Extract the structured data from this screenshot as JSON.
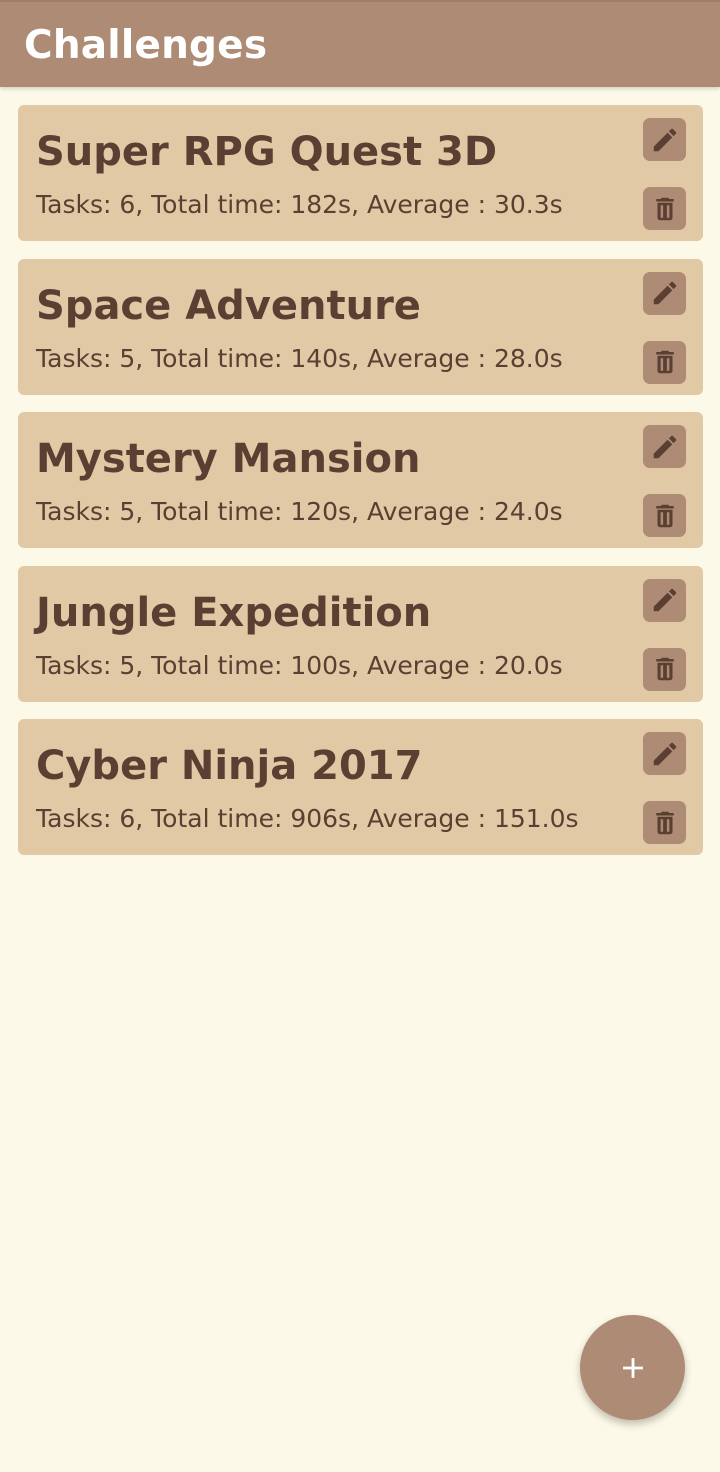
{
  "app_bar": {
    "title": "Challenges",
    "color": "#ae8b74"
  },
  "colors": {
    "background": "#fdf9e8",
    "card": "#e2c9a5",
    "text": "#5b3f33",
    "button": "#ae8b74"
  },
  "challenges": [
    {
      "title": "Super RPG Quest 3D",
      "stats": "Tasks: 6, Total time: 182s, Average : 30.3s",
      "edit_icon": "pencil-icon",
      "delete_icon": "trash-icon"
    },
    {
      "title": "Space Adventure",
      "stats": "Tasks: 5, Total time: 140s, Average : 28.0s",
      "edit_icon": "pencil-icon",
      "delete_icon": "trash-icon"
    },
    {
      "title": "Mystery Mansion",
      "stats": "Tasks: 5, Total time: 120s, Average : 24.0s",
      "edit_icon": "pencil-icon",
      "delete_icon": "trash-icon"
    },
    {
      "title": "Jungle Expedition",
      "stats": "Tasks: 5, Total time: 100s, Average : 20.0s",
      "edit_icon": "pencil-icon",
      "delete_icon": "trash-icon"
    },
    {
      "title": "Cyber Ninja 2017",
      "stats": "Tasks: 6, Total time: 906s, Average : 151.0s",
      "edit_icon": "pencil-icon",
      "delete_icon": "trash-icon"
    }
  ],
  "fab": {
    "icon": "plus-icon"
  }
}
